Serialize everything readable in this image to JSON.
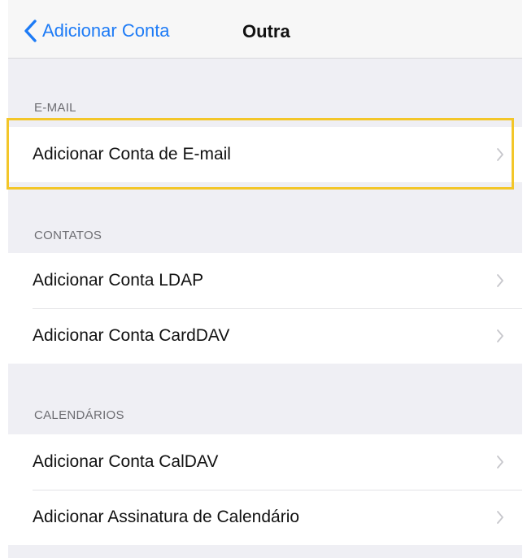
{
  "navbar": {
    "back_label": "Adicionar Conta",
    "title": "Outra"
  },
  "sections": {
    "email": {
      "header": "E-MAIL",
      "rows": [
        {
          "label": "Adicionar Conta de E-mail"
        }
      ]
    },
    "contacts": {
      "header": "CONTATOS",
      "rows": [
        {
          "label": "Adicionar Conta LDAP"
        },
        {
          "label": "Adicionar Conta CardDAV"
        }
      ]
    },
    "calendars": {
      "header": "CALENDÁRIOS",
      "rows": [
        {
          "label": "Adicionar Conta CalDAV"
        },
        {
          "label": "Adicionar Assinatura de Calendário"
        }
      ]
    }
  },
  "colors": {
    "accent": "#1d7bf6",
    "highlight_border": "#f3c629",
    "background": "#efeff4"
  },
  "icons": {
    "back": "chevron-left-icon",
    "row": "chevron-right-icon"
  }
}
